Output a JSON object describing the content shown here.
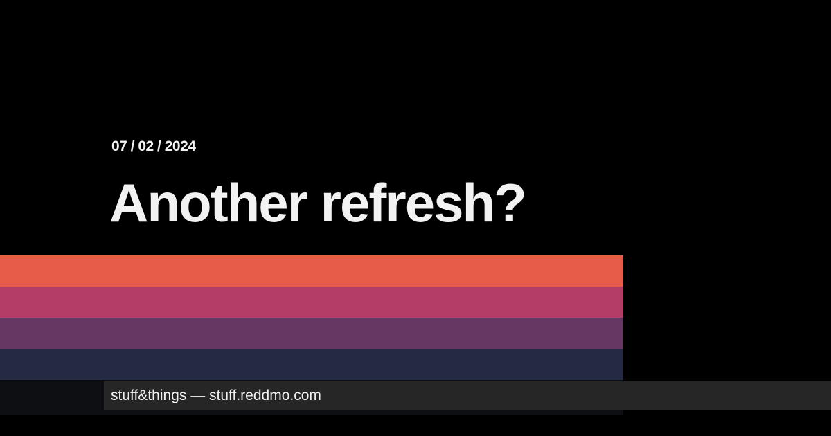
{
  "post": {
    "date": "07 / 02 / 2024",
    "title": "Another refresh?"
  },
  "footer": {
    "site_name": "stuff&things",
    "separator": "—",
    "domain": "stuff.reddmo.com"
  },
  "colors": {
    "background": "#000000",
    "text": "#f2f2f2",
    "stripe_1": "#e65c48",
    "stripe_2": "#b43d68",
    "stripe_3": "#663763",
    "stripe_4": "#242a43",
    "footer_bar": "#262626"
  }
}
